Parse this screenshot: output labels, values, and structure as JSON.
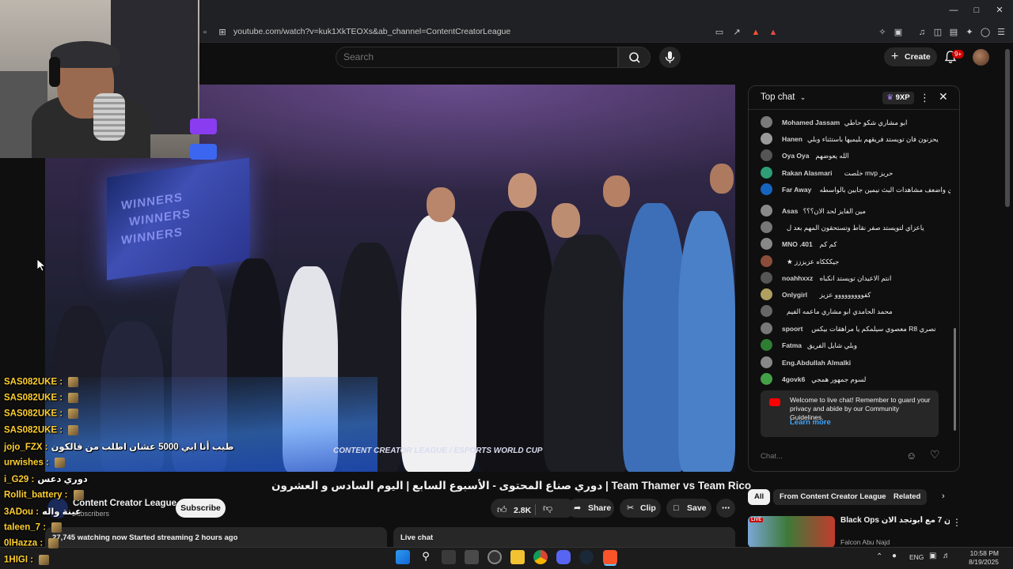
{
  "browser": {
    "url": "youtube.com/watch?v=kuk1XkTEOXs&ab_channel=ContentCreatorLeague",
    "window_controls": [
      "minimize-icon",
      "maximize-icon",
      "close-icon"
    ]
  },
  "header": {
    "search_placeholder": "Search",
    "create_label": "Create",
    "notification_count": "9+"
  },
  "video": {
    "watermark": "CONTENT CREATOR LEAGUE / ESPORTS WORLD CUP",
    "screen_text": "WINNERS",
    "title": "دوري صناع المحتوى - الأسبوع السابع | اليوم السادس و العشرون | Team Thamer vs Team Rico",
    "channel": "Content Creator League",
    "subscribers": "subscribers",
    "subscribe_label": "Subscribe",
    "likes": "2.8K",
    "share_label": "Share",
    "clip_label": "Clip",
    "save_label": "Save",
    "stats": "27,745 watching now  Started streaming 2 hours ago",
    "live_chat_label": "Live chat"
  },
  "overlay_chat": [
    {
      "user": "SAS082UKE :",
      "text": ""
    },
    {
      "user": "SAS082UKE :",
      "text": ""
    },
    {
      "user": "SAS082UKE :",
      "text": ""
    },
    {
      "user": "SAS082UKE :",
      "text": ""
    },
    {
      "user": "jojo_FZX :",
      "text": "طيب أنا ابي 5000 عشان اطلب من فالكون"
    },
    {
      "user": "urwishes :",
      "text": ""
    },
    {
      "user": "i_G29 :",
      "text": "دوري دعس"
    },
    {
      "user": "Rollit_battery :",
      "text": ""
    },
    {
      "user": "3ADou :",
      "text": "عينة واله"
    },
    {
      "user": "taleen_7 :",
      "text": ""
    },
    {
      "user": "0lHazza :",
      "text": ""
    },
    {
      "user": "1HIGI :",
      "text": ""
    }
  ],
  "chat_panel": {
    "title": "Top chat",
    "xp": "9XP",
    "messages": [
      {
        "author": "Mohamed Jassam",
        "text": "ابو مشاري شكو حاطي",
        "color": "#7a7a7a"
      },
      {
        "author": "Hanen",
        "text": "يحزنون فان تويستد فريقهم بليميها باستثناء وبلي",
        "color": "#9a9a9a"
      },
      {
        "author": "Oya Oya",
        "text": "الله يعوضهم",
        "color": "#555"
      },
      {
        "author": "Rakan Alasmari",
        "text": "حريز mvp خلصت",
        "color": "#2e9e77"
      },
      {
        "author": "Far Away",
        "text": "اضعف حضور جماهيري واضعف مشاهدات البث نيمين جابين بالواسطه",
        "color": "#1565c0"
      },
      {
        "author": "Asas",
        "text": "مين الفايز لحد الان؟؟؟",
        "color": "#8a8a8a"
      },
      {
        "author": "",
        "text": "ياعزاي لتويستد صفر نقاط وتستحقون المهم بعد ل",
        "color": "#777"
      },
      {
        "author": "MNO .401",
        "text": "كم كم",
        "color": "#888"
      },
      {
        "author": "",
        "text": "جيكككاه عزيززز ★",
        "color": "#8b4d3a"
      },
      {
        "author": "noahhxxz",
        "text": "انتم الاعيدان تويستد انكباه",
        "color": "#555"
      },
      {
        "author": "Onlygirl",
        "text": "كفووووووووو عزيز",
        "color": "#b0a060"
      },
      {
        "author": "",
        "text": "محمد الحامدي ابو مشاري ماعمه الفيم",
        "color": "#666"
      },
      {
        "author": "spoort",
        "text": "نصري R8 معصوي سيلمكم يا مراهقات بيكس",
        "color": "#777"
      },
      {
        "author": "Fatma",
        "text": "وبلي شايل الفريق",
        "color": "#2e7d32"
      },
      {
        "author": "Eng.Abdullah Almalki",
        "text": "",
        "color": "#888"
      },
      {
        "author": "4govk6",
        "text": "لسوم جمهور همجي",
        "color": "#43a047"
      }
    ],
    "welcome": "Welcome to live chat! Remember to guard your privacy and abide by our Community Guidelines.",
    "learn_more": "Learn more",
    "input_placeholder": "Chat..."
  },
  "recommendations": {
    "chips": [
      "All",
      "From Content Creator League",
      "Related"
    ],
    "video_title": "Black Ops لايفوتاه .. الكشف العباشر عن 7 مع أبوتجد الان ...",
    "video_channel": "Falcon Abu Najd"
  },
  "taskbar": {
    "language": "ENG",
    "time": "10:58 PM",
    "date": "8/19/2025"
  }
}
